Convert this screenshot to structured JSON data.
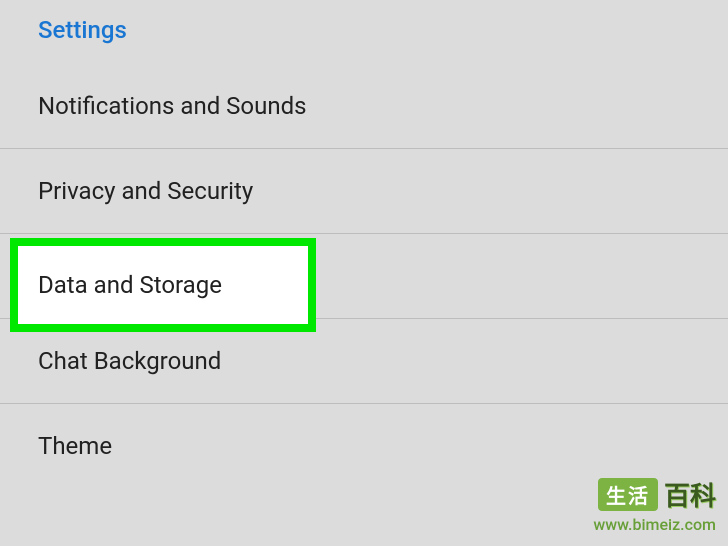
{
  "section_title": "Settings",
  "items": [
    {
      "label": "Notifications and Sounds",
      "value": ""
    },
    {
      "label": "Privacy and Security",
      "value": ""
    },
    {
      "label": "Data and Storage",
      "value": ""
    },
    {
      "label": "Chat Background",
      "value": ""
    },
    {
      "label": "Theme",
      "value": ""
    }
  ],
  "highlight": {
    "label": "Data and Storage"
  },
  "watermark": {
    "badge": "生活",
    "chars": "百科",
    "url": "www.bimeiz.com"
  }
}
